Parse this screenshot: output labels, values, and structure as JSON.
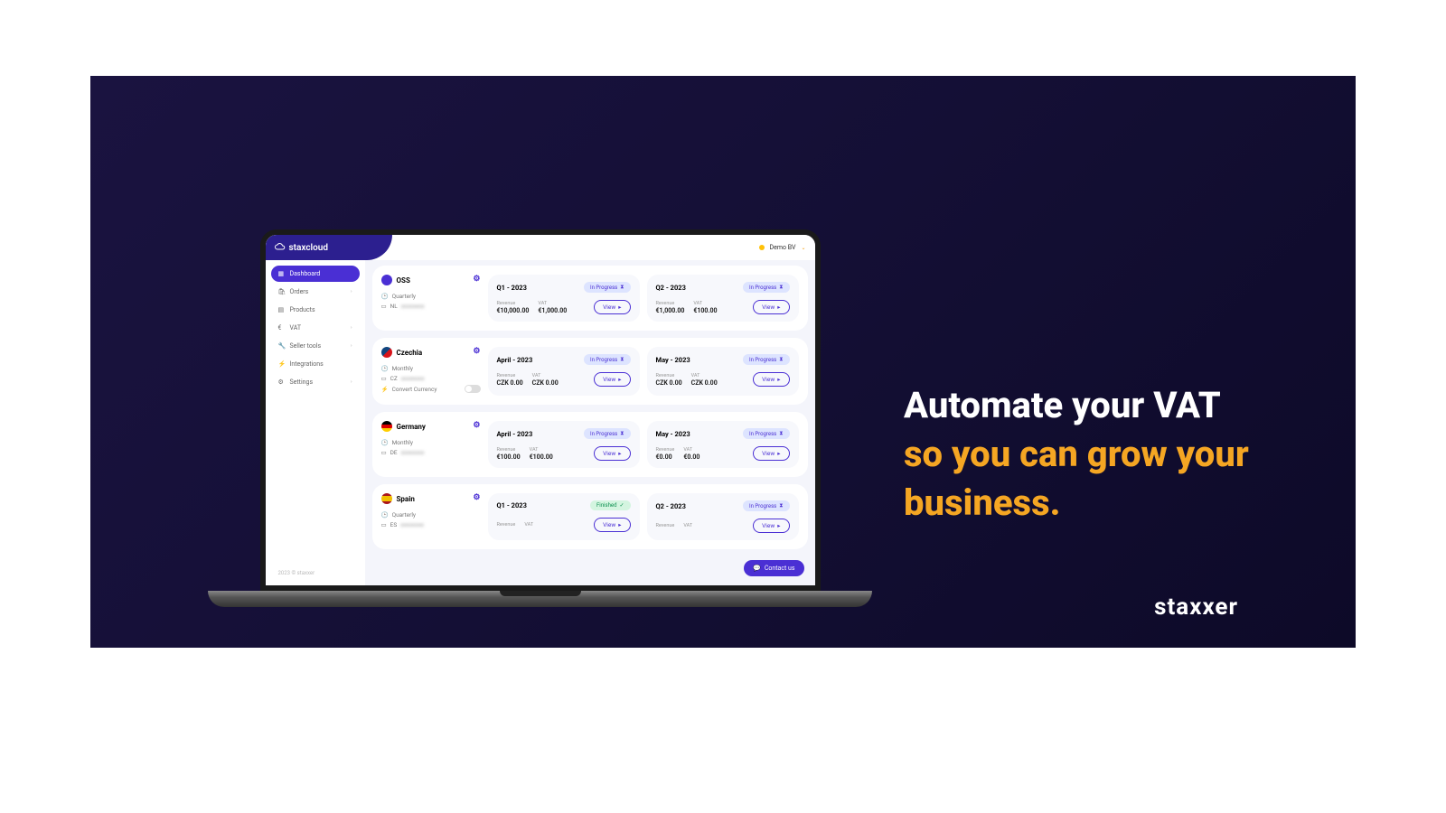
{
  "hero": {
    "headline_white": "Automate your VAT",
    "headline_accent": "so you can grow your business.",
    "brand": "staxxer"
  },
  "app": {
    "logo": "staxcloud",
    "account": "Demo BV",
    "footer": "2023 © staxxer",
    "contact": "Contact us"
  },
  "sidebar": [
    {
      "icon": "▦",
      "label": "Dashboard",
      "active": true,
      "sub": false
    },
    {
      "icon": "🛍",
      "label": "Orders",
      "active": false,
      "sub": true
    },
    {
      "icon": "▤",
      "label": "Products",
      "active": false,
      "sub": false
    },
    {
      "icon": "€",
      "label": "VAT",
      "active": false,
      "sub": true
    },
    {
      "icon": "🔧",
      "label": "Seller tools",
      "active": false,
      "sub": true
    },
    {
      "icon": "⚡",
      "label": "Integrations",
      "active": false,
      "sub": false
    },
    {
      "icon": "⚙",
      "label": "Settings",
      "active": false,
      "sub": true
    }
  ],
  "labels": {
    "revenue": "Revenue",
    "vat": "VAT",
    "view": "View",
    "in_progress": "In Progress",
    "finished": "Finished",
    "convert_currency": "Convert Currency",
    "quarterly": "Quarterly",
    "monthly": "Monthly"
  },
  "regions": [
    {
      "name": "OSS",
      "flag": "oss",
      "freq": "Quarterly",
      "country_code": "NL",
      "toggle": false,
      "periods": [
        {
          "title": "Q1 - 2023",
          "status": "prog",
          "revenue": "€10,000.00",
          "vat": "€1,000.00"
        },
        {
          "title": "Q2 - 2023",
          "status": "prog",
          "revenue": "€1,000.00",
          "vat": "€100.00"
        }
      ]
    },
    {
      "name": "Czechia",
      "flag": "cz",
      "freq": "Monthly",
      "country_code": "CZ",
      "toggle": true,
      "periods": [
        {
          "title": "April - 2023",
          "status": "prog",
          "revenue": "CZK 0.00",
          "vat": "CZK 0.00"
        },
        {
          "title": "May - 2023",
          "status": "prog",
          "revenue": "CZK 0.00",
          "vat": "CZK 0.00"
        }
      ]
    },
    {
      "name": "Germany",
      "flag": "de",
      "freq": "Monthly",
      "country_code": "DE",
      "toggle": false,
      "periods": [
        {
          "title": "April - 2023",
          "status": "prog",
          "revenue": "€100.00",
          "vat": "€100.00"
        },
        {
          "title": "May - 2023",
          "status": "prog",
          "revenue": "€0.00",
          "vat": "€0.00"
        }
      ]
    },
    {
      "name": "Spain",
      "flag": "es",
      "freq": "Quarterly",
      "country_code": "ES",
      "toggle": false,
      "periods": [
        {
          "title": "Q1 - 2023",
          "status": "fin",
          "revenue": "",
          "vat": ""
        },
        {
          "title": "Q2 - 2023",
          "status": "prog",
          "revenue": "",
          "vat": ""
        }
      ]
    }
  ]
}
